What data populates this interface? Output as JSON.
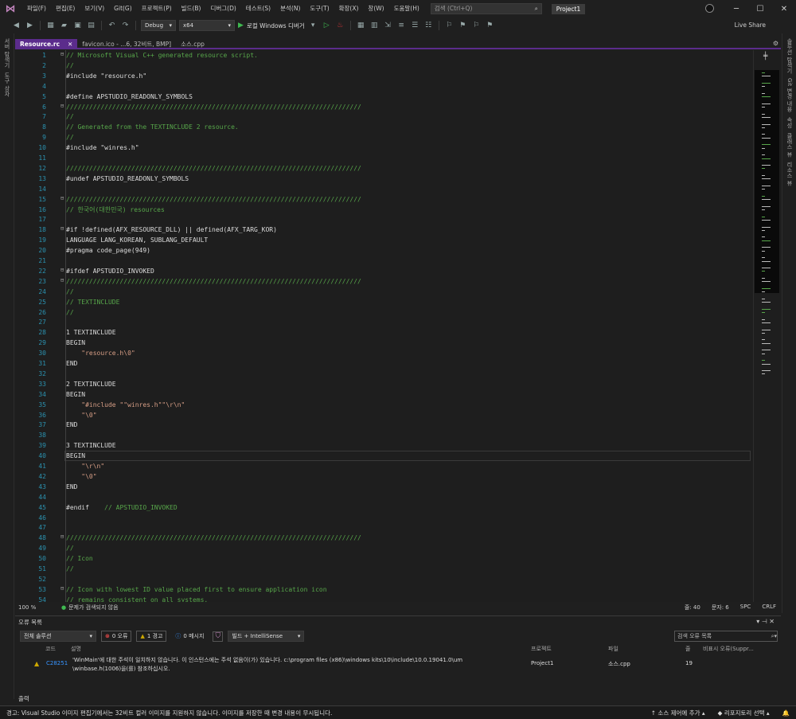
{
  "titlebar": {
    "logo": "⋈",
    "menu": [
      "파일(F)",
      "편집(E)",
      "보기(V)",
      "Git(G)",
      "프로젝트(P)",
      "빌드(B)",
      "디버그(D)",
      "테스트(S)",
      "분석(N)",
      "도구(T)",
      "확장(X)",
      "창(W)",
      "도움말(H)"
    ],
    "search_placeholder": "검색 (Ctrl+Q)",
    "project_name": "Project1",
    "live_share": "Live Share"
  },
  "toolbar": {
    "config": "Debug",
    "platform": "x64",
    "debugger": "로컬 Windows 디버거"
  },
  "left_strip": [
    "서버 탐색기",
    "도구 상자"
  ],
  "right_strip": [
    "솔루션 탐색기",
    "Git 변경 내용",
    "속성",
    "클래스 뷰",
    "리소스 뷰"
  ],
  "tabs": [
    {
      "label": "Resource.rc",
      "close": "✕",
      "active": true
    },
    {
      "label": "favicon.ico - ...6, 32비트, BMP]",
      "close": "",
      "active": false
    },
    {
      "label": "소스.cpp",
      "close": "",
      "active": false
    }
  ],
  "editor": {
    "lines": [
      {
        "n": "1",
        "t": "// Microsoft Visual C++ generated resource script.",
        "c": "comment",
        "fold": "⊟"
      },
      {
        "n": "2",
        "t": "//",
        "c": "comment"
      },
      {
        "n": "3",
        "t": "#include \"resource.h\"",
        "c": "text"
      },
      {
        "n": "4",
        "t": "",
        "c": "text"
      },
      {
        "n": "5",
        "t": "#define APSTUDIO_READONLY_SYMBOLS",
        "c": "text"
      },
      {
        "n": "6",
        "t": "/////////////////////////////////////////////////////////////////////////////",
        "c": "comment",
        "fold": "⊟"
      },
      {
        "n": "7",
        "t": "//",
        "c": "comment"
      },
      {
        "n": "8",
        "t": "// Generated from the TEXTINCLUDE 2 resource.",
        "c": "comment"
      },
      {
        "n": "9",
        "t": "//",
        "c": "comment"
      },
      {
        "n": "10",
        "t": "#include \"winres.h\"",
        "c": "text"
      },
      {
        "n": "11",
        "t": "",
        "c": "text"
      },
      {
        "n": "12",
        "t": "/////////////////////////////////////////////////////////////////////////////",
        "c": "comment"
      },
      {
        "n": "13",
        "t": "#undef APSTUDIO_READONLY_SYMBOLS",
        "c": "text"
      },
      {
        "n": "14",
        "t": "",
        "c": "text"
      },
      {
        "n": "15",
        "t": "/////////////////////////////////////////////////////////////////////////////",
        "c": "comment",
        "fold": "⊟"
      },
      {
        "n": "16",
        "t": "// 한국어(대한민국) resources",
        "c": "comment"
      },
      {
        "n": "17",
        "t": "",
        "c": "text"
      },
      {
        "n": "18",
        "t": "#if !defined(AFX_RESOURCE_DLL) || defined(AFX_TARG_KOR)",
        "c": "text",
        "fold": "⊟"
      },
      {
        "n": "19",
        "t": "LANGUAGE LANG_KOREAN, SUBLANG_DEFAULT",
        "c": "text"
      },
      {
        "n": "20",
        "t": "#pragma code_page(949)",
        "c": "text"
      },
      {
        "n": "21",
        "t": "",
        "c": "text"
      },
      {
        "n": "22",
        "t": "#ifdef APSTUDIO_INVOKED",
        "c": "text",
        "fold": "⊟"
      },
      {
        "n": "23",
        "t": "/////////////////////////////////////////////////////////////////////////////",
        "c": "comment",
        "fold": "⊟"
      },
      {
        "n": "24",
        "t": "//",
        "c": "comment"
      },
      {
        "n": "25",
        "t": "// TEXTINCLUDE",
        "c": "comment"
      },
      {
        "n": "26",
        "t": "//",
        "c": "comment"
      },
      {
        "n": "27",
        "t": "",
        "c": "text"
      },
      {
        "n": "28",
        "t": "1 TEXTINCLUDE",
        "c": "text"
      },
      {
        "n": "29",
        "t": "BEGIN",
        "c": "text"
      },
      {
        "n": "30",
        "t": "    \"resource.h\\0\"",
        "c": "string"
      },
      {
        "n": "31",
        "t": "END",
        "c": "text"
      },
      {
        "n": "32",
        "t": "",
        "c": "text"
      },
      {
        "n": "33",
        "t": "2 TEXTINCLUDE",
        "c": "text"
      },
      {
        "n": "34",
        "t": "BEGIN",
        "c": "text"
      },
      {
        "n": "35",
        "t": "    \"#include \"\"winres.h\"\"\\r\\n\"",
        "c": "string"
      },
      {
        "n": "36",
        "t": "    \"\\0\"",
        "c": "string"
      },
      {
        "n": "37",
        "t": "END",
        "c": "text"
      },
      {
        "n": "38",
        "t": "",
        "c": "text"
      },
      {
        "n": "39",
        "t": "3 TEXTINCLUDE",
        "c": "text"
      },
      {
        "n": "40",
        "t": "BEGIN",
        "c": "text"
      },
      {
        "n": "41",
        "t": "    \"\\r\\n\"",
        "c": "string"
      },
      {
        "n": "42",
        "t": "    \"\\0\"",
        "c": "string"
      },
      {
        "n": "43",
        "t": "END",
        "c": "text"
      },
      {
        "n": "44",
        "t": "",
        "c": "text"
      },
      {
        "n": "45",
        "t": "#endif    // APSTUDIO_INVOKED",
        "c": "mixed"
      },
      {
        "n": "46",
        "t": "",
        "c": "text"
      },
      {
        "n": "47",
        "t": "",
        "c": "text"
      },
      {
        "n": "48",
        "t": "/////////////////////////////////////////////////////////////////////////////",
        "c": "comment",
        "fold": "⊟"
      },
      {
        "n": "49",
        "t": "//",
        "c": "comment"
      },
      {
        "n": "50",
        "t": "// Icon",
        "c": "comment"
      },
      {
        "n": "51",
        "t": "//",
        "c": "comment"
      },
      {
        "n": "52",
        "t": "",
        "c": "text"
      },
      {
        "n": "53",
        "t": "// Icon with lowest ID value placed first to ensure application icon",
        "c": "comment",
        "fold": "⊟"
      },
      {
        "n": "54",
        "t": "// remains consistent on all systems.",
        "c": "comment"
      }
    ]
  },
  "editor_status": {
    "zoom": "100 %",
    "ok_icon": "●",
    "ok_text": "문제가 검색되지 않음",
    "line": "줄: 40",
    "col": "문자: 6",
    "spc": "SPC",
    "eol": "CRLF"
  },
  "error_panel": {
    "title": "오류 목록",
    "scope": "전체 솔루션",
    "errors_count": "0 오류",
    "warnings_count": "1 경고",
    "messages_count": "0 메시지",
    "build_filter": "빌드 + IntelliSense",
    "search_placeholder": "검색 오류 목록",
    "headers": [
      "코드",
      "설명",
      "프로젝트",
      "파일",
      "줄",
      "비표시 오류(Suppr..."
    ],
    "rows": [
      {
        "code": "C28251",
        "description_line1": "'WinMain'에 대한 주석이 일치하지 않습니다. 이 인스턴스에는 주석 없음이(가) 있습니다. c:\\program files (x86)\\windows kits\\10\\include\\10.0.19041.0\\um",
        "description_line2": "\\winbase.h(1006)을(를) 참조하십시오.",
        "project": "Project1",
        "file": "소스.cpp",
        "line": "19"
      }
    ]
  },
  "output_tab": "출력",
  "statusbar": {
    "message": "경고: Visual Studio 이미지 편집기에서는 32비트 컬러 이미지를 지원하지 않습니다. 이미지를 저장한 때 변경 내용이 무시됩니다.",
    "source_control": "소스 제어에 추가",
    "repo": "리포지토리 선택",
    "bell": "🔔"
  },
  "colors": {
    "accent": "#5b2c8c",
    "comment": "#57a64a",
    "line_number": "#2b91af",
    "string": "#d69d85",
    "error": "#f14c4c",
    "warning": "#cca700"
  }
}
